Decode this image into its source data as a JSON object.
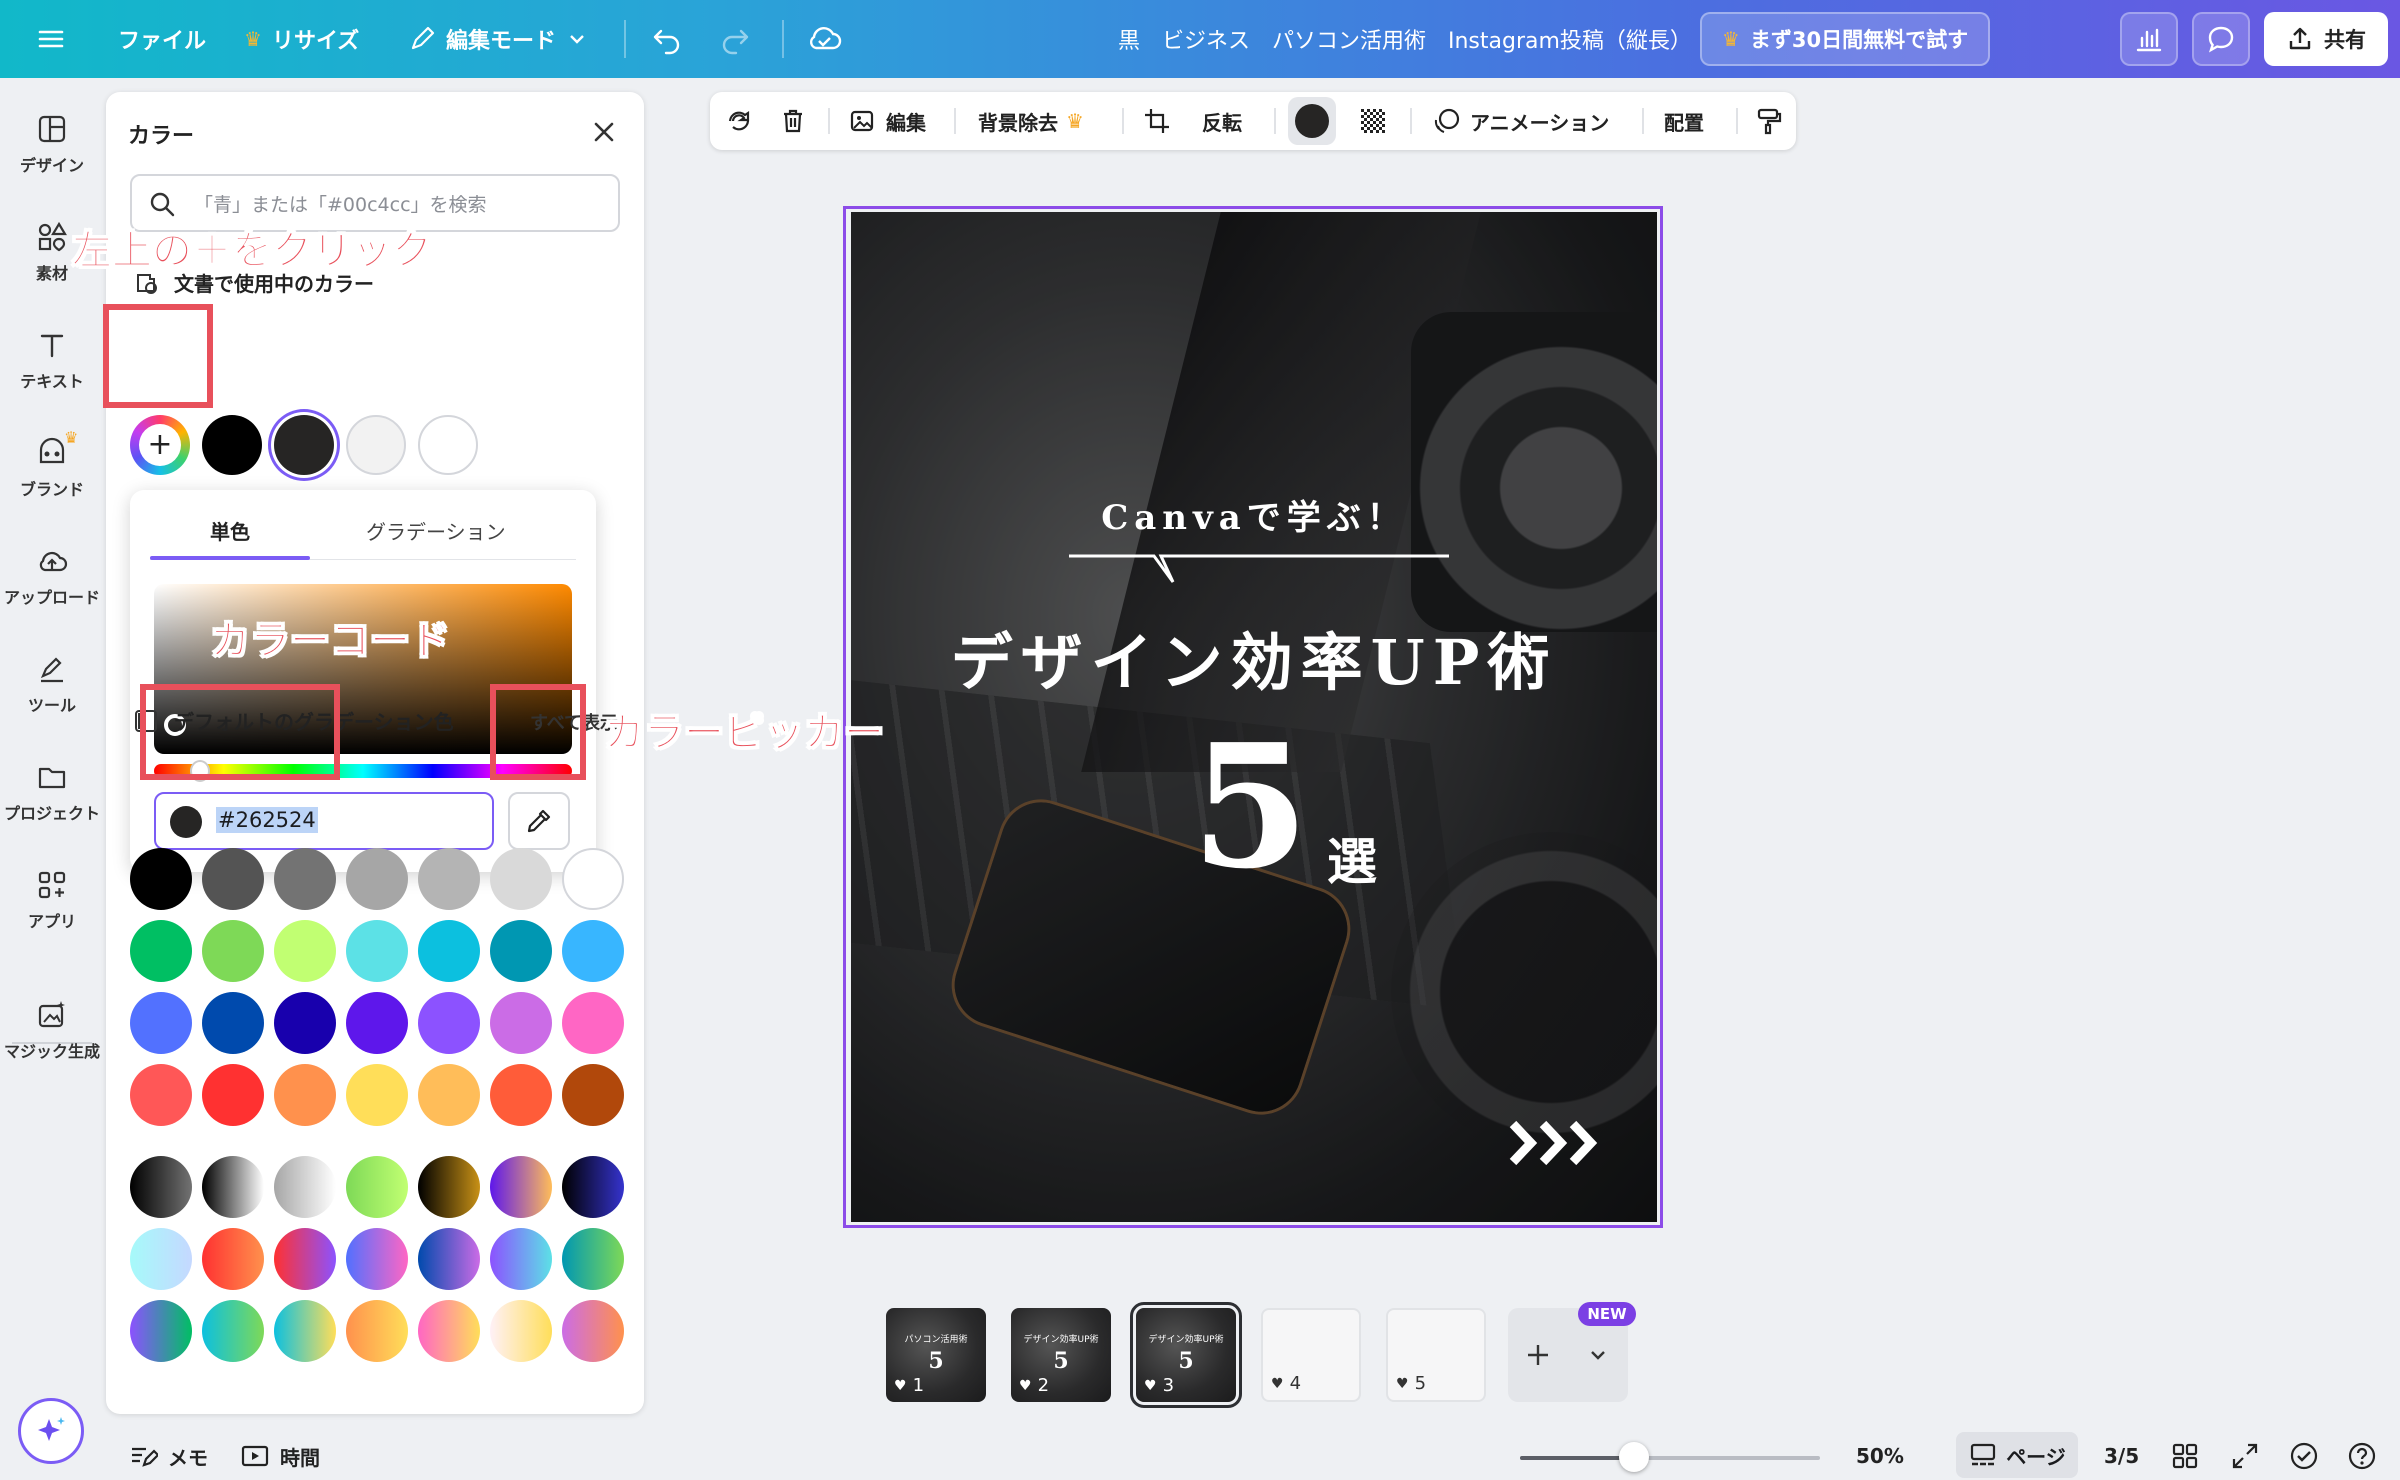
{
  "topbar": {
    "file": "ファイル",
    "resize": "リサイズ",
    "edit_mode": "編集モード",
    "doc_title": "黒　ビジネス　パソコン活用術　Instagram投稿（縦長）",
    "trial": "まず30日間無料で試す",
    "share": "共有"
  },
  "rail": {
    "items": [
      {
        "label": "デザイン",
        "icon": "design-icon"
      },
      {
        "label": "素材",
        "icon": "elements-icon"
      },
      {
        "label": "テキスト",
        "icon": "text-icon"
      },
      {
        "label": "ブランド",
        "icon": "brand-icon"
      },
      {
        "label": "アップロード",
        "icon": "upload-icon"
      },
      {
        "label": "ツール",
        "icon": "tools-icon"
      },
      {
        "label": "プロジェクト",
        "icon": "folder-icon"
      },
      {
        "label": "アプリ",
        "icon": "apps-icon"
      },
      {
        "label": "マジック生成",
        "icon": "magic-icon"
      }
    ]
  },
  "color_panel": {
    "title": "カラー",
    "search_placeholder": "「青」または「#00c4cc」を検索",
    "doc_colors_label": "文書で使用中のカラー",
    "doc_colors": [
      "#000000",
      "#262524",
      "#f2f2f2",
      "#ffffff"
    ],
    "tabs": [
      "単色",
      "グラデーション"
    ],
    "hex_value": "#262524",
    "default_gradient_label": "デフォルトのグラデーション色",
    "see_all": "すべて表示",
    "solid_rows": [
      [
        "#000000",
        "#545454",
        "#737373",
        "#a6a6a6",
        "#b4b4b4",
        "#d9d9d9",
        "#ffffff"
      ],
      [
        "#00bf63",
        "#7ed957",
        "#c1ff72",
        "#5ce1e6",
        "#0cc0df",
        "#0097b2",
        "#38b6ff"
      ],
      [
        "#5271ff",
        "#004aad",
        "#1800ad",
        "#5e17eb",
        "#8c52ff",
        "#cb6ce6",
        "#ff66c4"
      ],
      [
        "#ff5757",
        "#ff3131",
        "#ff914d",
        "#ffde59",
        "#ffbd59",
        "#ff5c39",
        "#b1480b"
      ]
    ],
    "gradient_rows": [
      [
        [
          "#000000",
          "#737373"
        ],
        [
          "#000000",
          "#ffffff"
        ],
        [
          "#a6a6a6",
          "#ffffff"
        ],
        [
          "#7ed957",
          "#c1ff72"
        ],
        [
          "#000000",
          "#c89116"
        ],
        [
          "#5e17eb",
          "#ffbd59"
        ],
        [
          "#000000",
          "#3533cd"
        ]
      ],
      [
        [
          "#a6fafa",
          "#c5d8ff"
        ],
        [
          "#ff3131",
          "#ff914d"
        ],
        [
          "#ff3131",
          "#8c52ff"
        ],
        [
          "#5170ff",
          "#ff66c4"
        ],
        [
          "#004aad",
          "#cb6ce6"
        ],
        [
          "#8c52ff",
          "#5ce1e6"
        ],
        [
          "#0097b2",
          "#7ed957"
        ]
      ],
      [
        [
          "#8c52ff",
          "#00bf63"
        ],
        [
          "#0cc0df",
          "#7ed957"
        ],
        [
          "#0cc0df",
          "#ffde59"
        ],
        [
          "#ff914d",
          "#ffde59"
        ],
        [
          "#ff66c4",
          "#ffde59"
        ],
        [
          "#fff1f7",
          "#ffde59"
        ],
        [
          "#cb6ce6",
          "#ff914d"
        ]
      ]
    ]
  },
  "canvas_toolbar": {
    "edit": "編集",
    "bg_remove": "背景除去",
    "flip": "反転",
    "animate": "アニメーション",
    "position": "配置"
  },
  "design": {
    "subtitle": "Canvaで学ぶ！",
    "title": "デザイン効率UP術",
    "number": "5",
    "unit": "選"
  },
  "pages": {
    "thumbs": [
      {
        "num": "1",
        "theme": "dark",
        "mini_title": "パソコン活用術"
      },
      {
        "num": "2",
        "theme": "dark",
        "mini_title": "デザイン効率UP術"
      },
      {
        "num": "3",
        "theme": "dark",
        "mini_title": "デザイン効率UP術"
      },
      {
        "num": "4",
        "theme": "light",
        "mini_title": ""
      },
      {
        "num": "5",
        "theme": "light",
        "mini_title": ""
      }
    ],
    "new_badge": "NEW",
    "mini_number": "5"
  },
  "bottom_bar": {
    "notes": "メモ",
    "timer": "時間",
    "zoom": "50%",
    "zoom_fraction": 0.38,
    "pages_label": "ページ",
    "page_counter": "3/5"
  },
  "annotations": {
    "plus_hint": "左上の＋をクリック",
    "color_code": "カラーコード",
    "color_picker": "カラーピッカー"
  }
}
